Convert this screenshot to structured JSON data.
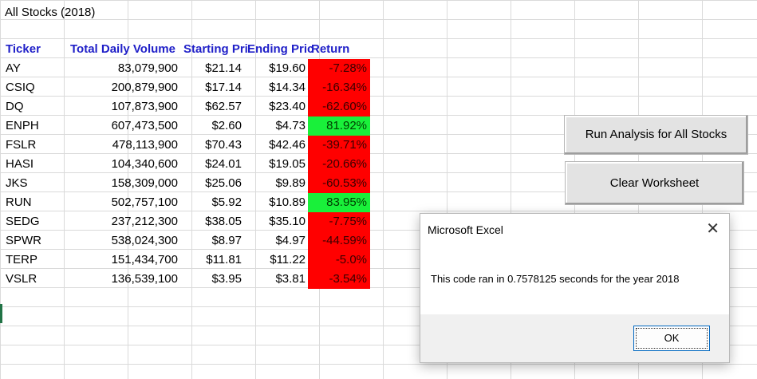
{
  "sheet": {
    "title": "All Stocks (2018)",
    "headers": {
      "ticker": "Ticker",
      "volume": "Total Daily Volume",
      "start": "Starting Pri",
      "end": "Ending Pric",
      "return": "Return"
    },
    "rows": [
      {
        "ticker": "AY",
        "volume": "83,079,900",
        "start": "$21.14",
        "end": "$19.60",
        "ret": "-7.28%",
        "sign": "neg"
      },
      {
        "ticker": "CSIQ",
        "volume": "200,879,900",
        "start": "$17.14",
        "end": "$14.34",
        "ret": "-16.34%",
        "sign": "neg"
      },
      {
        "ticker": "DQ",
        "volume": "107,873,900",
        "start": "$62.57",
        "end": "$23.40",
        "ret": "-62.60%",
        "sign": "neg"
      },
      {
        "ticker": "ENPH",
        "volume": "607,473,500",
        "start": "$2.60",
        "end": "$4.73",
        "ret": "81.92%",
        "sign": "pos"
      },
      {
        "ticker": "FSLR",
        "volume": "478,113,900",
        "start": "$70.43",
        "end": "$42.46",
        "ret": "-39.71%",
        "sign": "neg"
      },
      {
        "ticker": "HASI",
        "volume": "104,340,600",
        "start": "$24.01",
        "end": "$19.05",
        "ret": "-20.66%",
        "sign": "neg"
      },
      {
        "ticker": "JKS",
        "volume": "158,309,000",
        "start": "$25.06",
        "end": "$9.89",
        "ret": "-60.53%",
        "sign": "neg"
      },
      {
        "ticker": "RUN",
        "volume": "502,757,100",
        "start": "$5.92",
        "end": "$10.89",
        "ret": "83.95%",
        "sign": "pos"
      },
      {
        "ticker": "SEDG",
        "volume": "237,212,300",
        "start": "$38.05",
        "end": "$35.10",
        "ret": "-7.75%",
        "sign": "neg"
      },
      {
        "ticker": "SPWR",
        "volume": "538,024,300",
        "start": "$8.97",
        "end": "$4.97",
        "ret": "-44.59%",
        "sign": "neg"
      },
      {
        "ticker": "TERP",
        "volume": "151,434,700",
        "start": "$11.81",
        "end": "$11.22",
        "ret": "-5.0%",
        "sign": "neg"
      },
      {
        "ticker": "VSLR",
        "volume": "136,539,100",
        "start": "$3.95",
        "end": "$3.81",
        "ret": "-3.54%",
        "sign": "neg"
      }
    ]
  },
  "buttons": {
    "run_label": "Run Analysis for All Stocks",
    "clear_label": "Clear Worksheet"
  },
  "dialog": {
    "title": "Microsoft Excel",
    "close_glyph": "✕",
    "message": "This code ran in 0.7578125 seconds for the year 2018",
    "ok_label": "OK"
  },
  "colors": {
    "negative": "#ff0000",
    "positive": "#19f03a",
    "header_text": "#1f1fc8"
  }
}
